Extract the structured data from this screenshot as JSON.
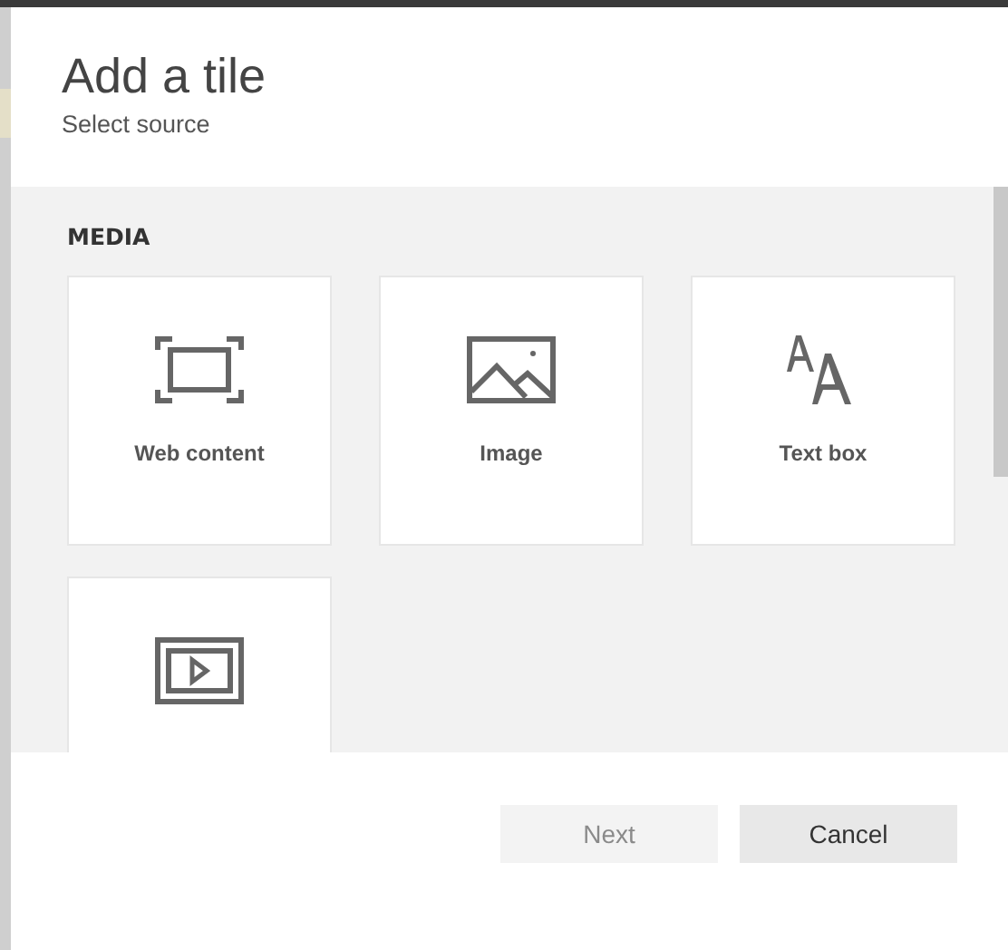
{
  "dialog": {
    "title": "Add a tile",
    "subtitle": "Select source"
  },
  "section": {
    "heading": "MEDIA"
  },
  "tiles": [
    {
      "kind": "web",
      "label": "Web content"
    },
    {
      "kind": "image",
      "label": "Image"
    },
    {
      "kind": "text",
      "label": "Text box"
    },
    {
      "kind": "video"
    }
  ],
  "buttons": [
    {
      "label": "Next",
      "disabled": true
    },
    {
      "label": "Cancel",
      "disabled": false
    }
  ]
}
